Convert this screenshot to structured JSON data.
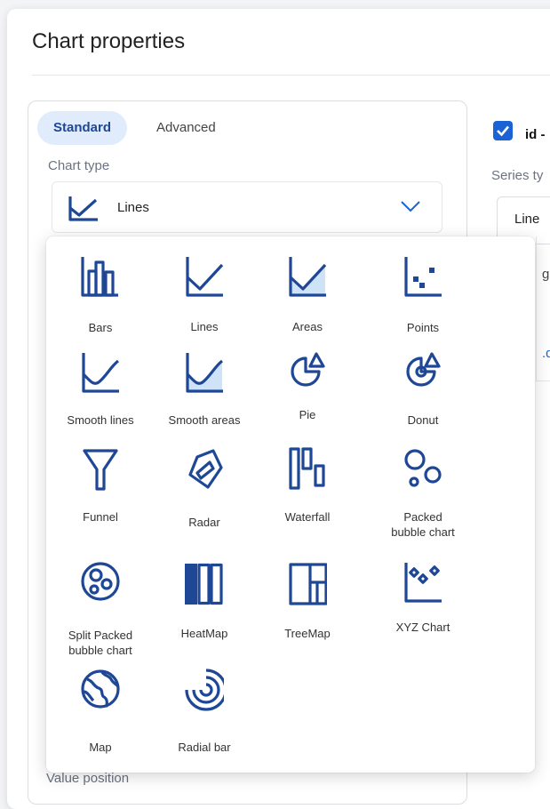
{
  "dialog": {
    "title": "Chart properties"
  },
  "tabs": [
    {
      "label": "Standard",
      "active": true
    },
    {
      "label": "Advanced",
      "active": false
    }
  ],
  "chart_type": {
    "label": "Chart type",
    "selected": "Lines"
  },
  "right_panel": {
    "checkbox_label": "id -",
    "checked": true,
    "series_type_label": "Series ty",
    "series_type_value": "Line",
    "fragment_1": "ge",
    "fragment_2": ".dc"
  },
  "below_dropdown_label": "Value position",
  "chart_types": [
    {
      "label": "Bars",
      "icon": "bars-icon"
    },
    {
      "label": "Lines",
      "icon": "lines-icon"
    },
    {
      "label": "Areas",
      "icon": "areas-icon"
    },
    {
      "label": "Points",
      "icon": "points-icon"
    },
    {
      "label": "Smooth lines",
      "icon": "smooth-lines-icon"
    },
    {
      "label": "Smooth areas",
      "icon": "smooth-areas-icon"
    },
    {
      "label": "Pie",
      "icon": "pie-icon"
    },
    {
      "label": "Donut",
      "icon": "donut-icon"
    },
    {
      "label": "Funnel",
      "icon": "funnel-icon"
    },
    {
      "label": "Radar",
      "icon": "radar-icon"
    },
    {
      "label": "Waterfall",
      "icon": "waterfall-icon"
    },
    {
      "label": "Packed\nbubble chart",
      "icon": "packed-bubble-icon"
    },
    {
      "label": "Split Packed\nbubble chart",
      "icon": "split-packed-bubble-icon"
    },
    {
      "label": "HeatMap",
      "icon": "heatmap-icon"
    },
    {
      "label": "TreeMap",
      "icon": "treemap-icon"
    },
    {
      "label": "XYZ Chart",
      "icon": "xyz-chart-icon"
    },
    {
      "label": "Map",
      "icon": "map-icon"
    },
    {
      "label": "Radial bar",
      "icon": "radial-bar-icon"
    }
  ],
  "colors": {
    "accent": "#1e4796",
    "accent_fill": "#cfe3f8",
    "checkbox": "#1b62d6",
    "active_tab_bg": "#e0ebfb"
  }
}
